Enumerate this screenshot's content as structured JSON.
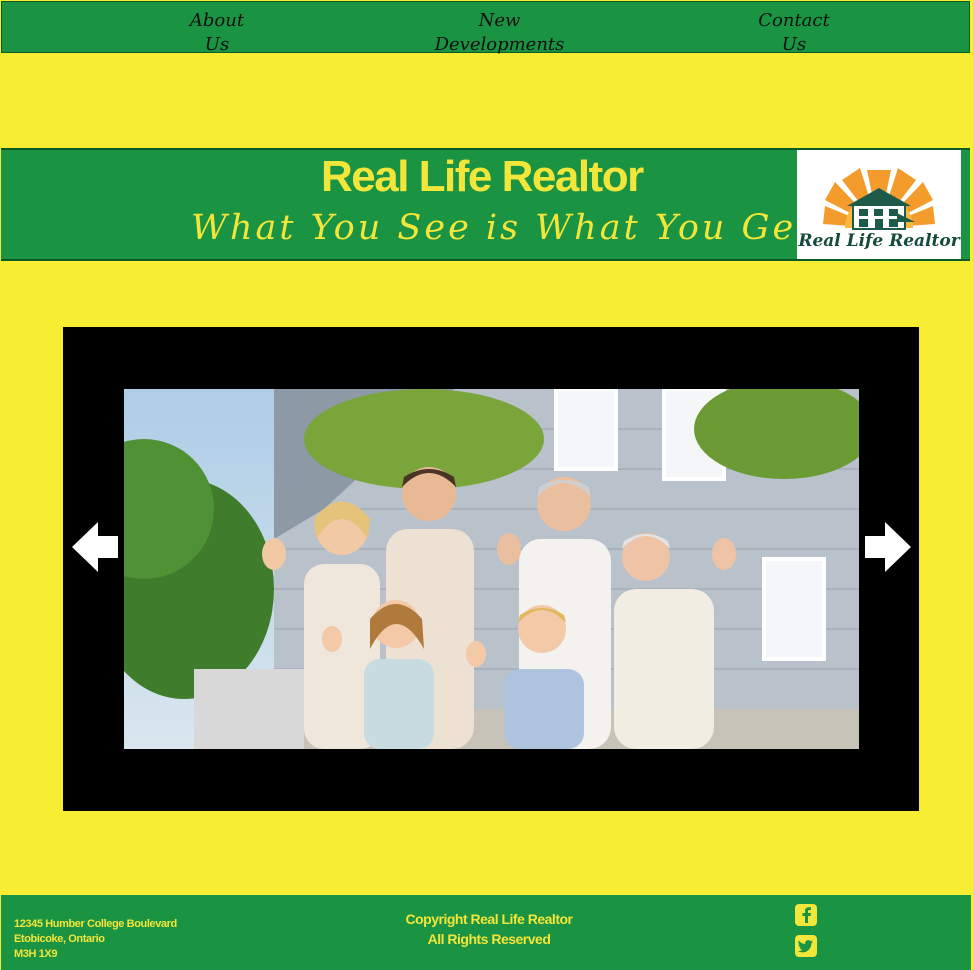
{
  "nav": {
    "items": [
      {
        "line1": "About",
        "line2": "Us"
      },
      {
        "line1": "New",
        "line2": "Developments"
      },
      {
        "line1": "Contact",
        "line2": "Us"
      }
    ]
  },
  "banner": {
    "title": "Real Life Realtor",
    "tagline": "What You See is What You Get",
    "logo_text": "Real Life Realtor"
  },
  "slider": {
    "prev_icon": "arrow-left-icon",
    "next_icon": "arrow-right-icon",
    "photo_subject": "family-in-front-of-house"
  },
  "footer": {
    "address": [
      "12345 Humber College Boulevard",
      "Etobicoke, Ontario",
      "M3H 1X9"
    ],
    "copyright": [
      "Copyright Real Life Realtor",
      "All Rights Reserved"
    ],
    "social": [
      "facebook-icon",
      "twitter-icon"
    ]
  },
  "colors": {
    "background": "#f7ee33",
    "green": "#1a9342",
    "yellow_text": "#f2e63a",
    "slider_bg": "#000000"
  }
}
